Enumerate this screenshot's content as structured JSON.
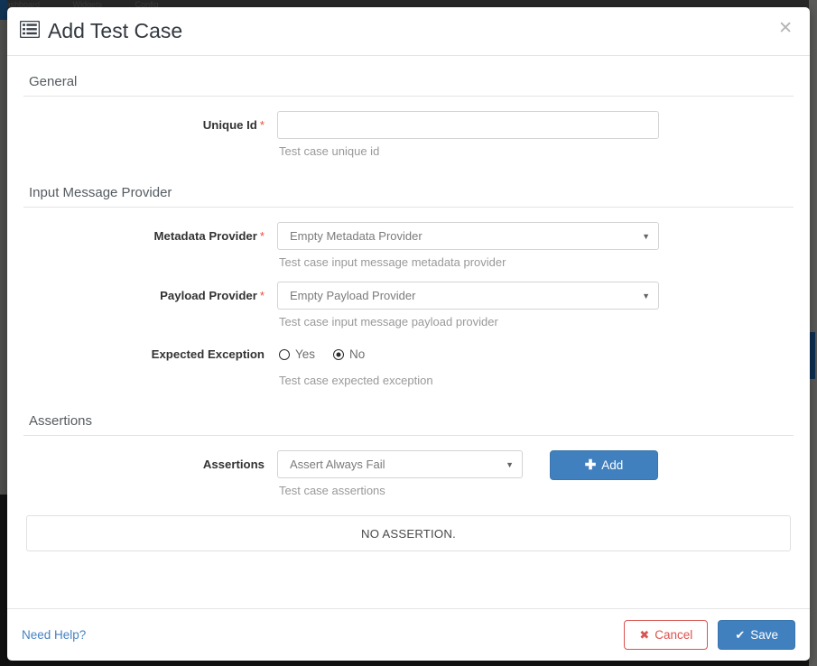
{
  "background": {
    "navbar_items": [
      "Dashboard",
      "Widgets",
      "Config"
    ],
    "accent_color": "#0d2f51"
  },
  "modal": {
    "title": "Add Test Case",
    "title_icon": "list-icon",
    "close_icon": "✕",
    "accent_color": "#4080bf",
    "required_marker": "*",
    "sections": {
      "general": {
        "heading": "General",
        "unique_id": {
          "label": "Unique Id",
          "value": "",
          "placeholder": "",
          "help": "Test case unique id",
          "required": true
        }
      },
      "input_message_provider": {
        "heading": "Input Message Provider",
        "metadata_provider": {
          "label": "Metadata Provider",
          "selected": "Empty Metadata Provider",
          "help": "Test case input message metadata provider",
          "required": true,
          "caret": "▼"
        },
        "payload_provider": {
          "label": "Payload Provider",
          "selected": "Empty Payload Provider",
          "help": "Test case input message payload provider",
          "required": true,
          "caret": "▼"
        },
        "expected_exception": {
          "label": "Expected Exception",
          "help": "Test case expected exception",
          "required": false,
          "options": [
            {
              "label": "Yes",
              "checked": false
            },
            {
              "label": "No",
              "checked": true
            }
          ]
        }
      },
      "assertions": {
        "heading": "Assertions",
        "field": {
          "label": "Assertions",
          "selected": "Assert Always Fail",
          "help": "Test case assertions",
          "required": false,
          "caret": "▼"
        },
        "add_button": {
          "label": "Add",
          "icon": "✚"
        },
        "empty_message": "NO ASSERTION."
      }
    },
    "footer": {
      "help_link": "Need Help?",
      "cancel": {
        "label": "Cancel",
        "icon": "✖"
      },
      "save": {
        "label": "Save",
        "icon": "✔"
      }
    }
  }
}
